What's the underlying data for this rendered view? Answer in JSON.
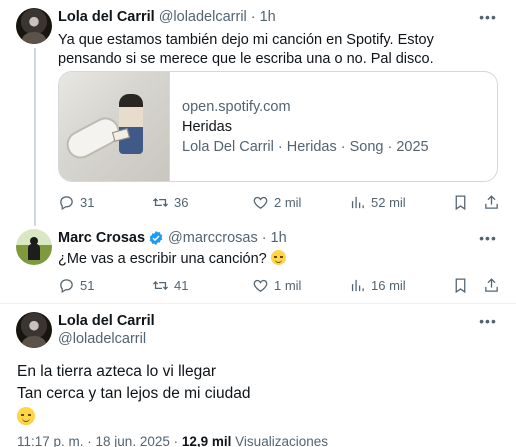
{
  "tweet1": {
    "name": "Lola del Carril",
    "handle": "@loladelcarril",
    "separator": "·",
    "time": "1h",
    "text": "Ya que estamos también dejo mi canción en Spotify. Estoy pensando si se merece que le escriba una o no. Pal disco.",
    "card": {
      "domain": "open.spotify.com",
      "title": "Heridas",
      "description": "Lola Del Carril · Heridas · Song · 2025"
    },
    "stats": {
      "replies": "31",
      "retweets": "36",
      "likes": "2 mil",
      "views": "52 mil"
    }
  },
  "tweet2": {
    "name": "Marc Crosas",
    "handle": "@marccrosas",
    "separator": "·",
    "time": "1h",
    "text": "¿Me vas a escribir una canción?",
    "emoji": "relieved-face",
    "stats": {
      "replies": "51",
      "retweets": "41",
      "likes": "1 mil",
      "views": "16 mil"
    }
  },
  "tweet3": {
    "name": "Lola del Carril",
    "handle": "@loladelcarril",
    "lines": [
      "En la tierra azteca lo vi llegar",
      "Tan cerca y tan lejos de mi ciudad"
    ],
    "emoji": "relieved-face",
    "meta": {
      "timestamp": "11:17 p. m. · 18 jun. 2025 ·",
      "views_count": "12,9 mil",
      "views_label": "Visualizaciones"
    }
  },
  "colors": {
    "text": "#0f1419",
    "secondary": "#536471",
    "border": "#cfd9de",
    "verified": "#1d9bf0"
  }
}
